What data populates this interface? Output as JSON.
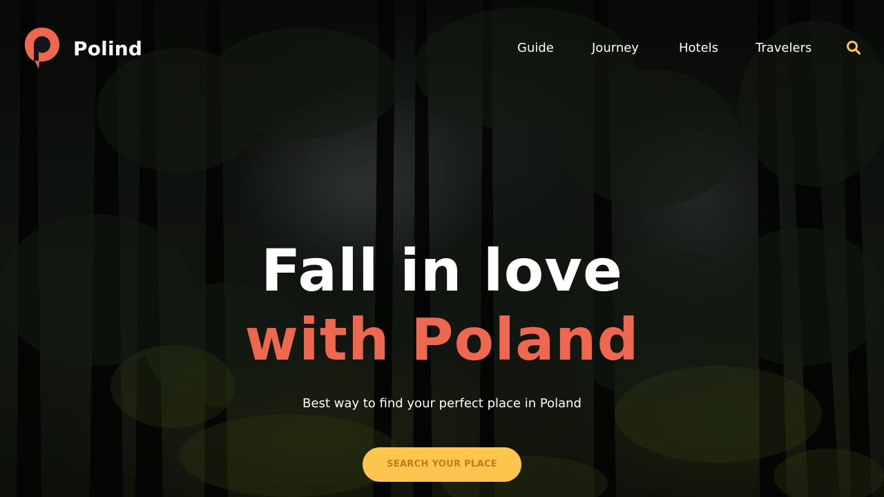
{
  "brand": {
    "name": "Polind",
    "logo_icon": "map-pin-p-icon",
    "accent_color": "#ee6850"
  },
  "nav": {
    "items": [
      {
        "label": "Guide"
      },
      {
        "label": "Journey"
      },
      {
        "label": "Hotels"
      },
      {
        "label": "Travelers"
      }
    ],
    "search_icon": "search-icon",
    "search_color": "#fcc64c"
  },
  "hero": {
    "title_line1": "Fall in love",
    "title_line2": "with Poland",
    "subtitle": "Best way to find your perfect place in Poland",
    "cta_label": "SEARCH YOUR PLACE",
    "cta_color": "#fcc64c",
    "background": "dark forest photo"
  }
}
